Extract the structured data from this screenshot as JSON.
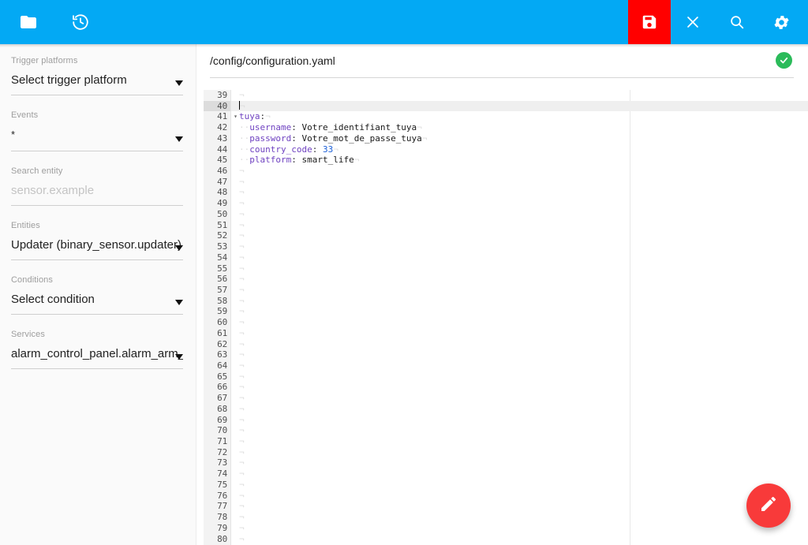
{
  "toolbar": {
    "buttons": [
      {
        "name": "browse-files-button",
        "icon": "folder-icon",
        "label": "Browse filesystem"
      },
      {
        "name": "restore-history-button",
        "icon": "history-restore-icon",
        "label": "Restore / history"
      },
      {
        "name": "save-button",
        "icon": "save-floppy-icon",
        "label": "Save",
        "bg": "#ff0000"
      },
      {
        "name": "close-button",
        "icon": "close-x-icon",
        "label": "Close"
      },
      {
        "name": "search-button",
        "icon": "search-icon",
        "label": "Search"
      },
      {
        "name": "settings-button",
        "icon": "gear-icon",
        "label": "Settings"
      }
    ],
    "accent_color": "#03a9f4",
    "save_color": "#ff0000"
  },
  "sidebar": {
    "fields": [
      {
        "name": "trigger-platforms",
        "label": "Trigger platforms",
        "value": "Select trigger platform",
        "placeholder": "",
        "is_placeholder": false
      },
      {
        "name": "events",
        "label": "Events",
        "value": "*",
        "placeholder": "",
        "is_placeholder": false
      },
      {
        "name": "search-entity",
        "label": "Search entity",
        "value": "",
        "placeholder": "sensor.example",
        "is_placeholder": true
      },
      {
        "name": "entities",
        "label": "Entities",
        "value": "Updater (binary_sensor.updater)",
        "placeholder": "",
        "is_placeholder": false
      },
      {
        "name": "conditions",
        "label": "Conditions",
        "value": "Select condition",
        "placeholder": "",
        "is_placeholder": false
      },
      {
        "name": "services",
        "label": "Services",
        "value": "alarm_control_panel.alarm_arm_aw…",
        "placeholder": "",
        "is_placeholder": false
      }
    ]
  },
  "main": {
    "file_path": "/config/configuration.yaml",
    "status_icon": "check-circle-icon",
    "status_color": "#2bbb5a"
  },
  "editor": {
    "first_visible_line": 39,
    "last_visible_line": 80,
    "active_line": 40,
    "cursor_line": 40,
    "fold_lines": [
      41
    ],
    "lines": [
      {
        "n": 39,
        "tokens": []
      },
      {
        "n": 40,
        "tokens": [],
        "cursor": true
      },
      {
        "n": 41,
        "tokens": [
          {
            "t": "key",
            "v": "tuya"
          },
          {
            "t": "punct",
            "v": ":"
          }
        ]
      },
      {
        "n": 42,
        "tokens": [
          {
            "t": "indent",
            "v": "  "
          },
          {
            "t": "key",
            "v": "username"
          },
          {
            "t": "punct",
            "v": ":"
          },
          {
            "t": "str",
            "v": " Votre_identifiant_tuya"
          }
        ]
      },
      {
        "n": 43,
        "tokens": [
          {
            "t": "indent",
            "v": "  "
          },
          {
            "t": "key",
            "v": "password"
          },
          {
            "t": "punct",
            "v": ":"
          },
          {
            "t": "str",
            "v": " Votre_mot_de_passe_tuya"
          }
        ]
      },
      {
        "n": 44,
        "tokens": [
          {
            "t": "indent",
            "v": "  "
          },
          {
            "t": "key",
            "v": "country_code"
          },
          {
            "t": "punct",
            "v": ":"
          },
          {
            "t": "num",
            "v": " 33"
          }
        ]
      },
      {
        "n": 45,
        "tokens": [
          {
            "t": "indent",
            "v": "  "
          },
          {
            "t": "key",
            "v": "platform"
          },
          {
            "t": "punct",
            "v": ":"
          },
          {
            "t": "str",
            "v": " smart_life"
          }
        ]
      },
      {
        "n": 46,
        "tokens": []
      },
      {
        "n": 47,
        "tokens": []
      },
      {
        "n": 48,
        "tokens": []
      },
      {
        "n": 49,
        "tokens": []
      },
      {
        "n": 50,
        "tokens": []
      },
      {
        "n": 51,
        "tokens": []
      },
      {
        "n": 52,
        "tokens": []
      },
      {
        "n": 53,
        "tokens": []
      },
      {
        "n": 54,
        "tokens": []
      },
      {
        "n": 55,
        "tokens": []
      },
      {
        "n": 56,
        "tokens": []
      },
      {
        "n": 57,
        "tokens": []
      },
      {
        "n": 58,
        "tokens": []
      },
      {
        "n": 59,
        "tokens": []
      },
      {
        "n": 60,
        "tokens": []
      },
      {
        "n": 61,
        "tokens": []
      },
      {
        "n": 62,
        "tokens": []
      },
      {
        "n": 63,
        "tokens": []
      },
      {
        "n": 64,
        "tokens": []
      },
      {
        "n": 65,
        "tokens": []
      },
      {
        "n": 66,
        "tokens": []
      },
      {
        "n": 67,
        "tokens": []
      },
      {
        "n": 68,
        "tokens": []
      },
      {
        "n": 69,
        "tokens": []
      },
      {
        "n": 70,
        "tokens": []
      },
      {
        "n": 71,
        "tokens": []
      },
      {
        "n": 72,
        "tokens": []
      },
      {
        "n": 73,
        "tokens": []
      },
      {
        "n": 74,
        "tokens": []
      },
      {
        "n": 75,
        "tokens": []
      },
      {
        "n": 76,
        "tokens": []
      },
      {
        "n": 77,
        "tokens": []
      },
      {
        "n": 78,
        "tokens": []
      },
      {
        "n": 79,
        "tokens": []
      },
      {
        "n": 80,
        "tokens": []
      }
    ]
  },
  "fab": {
    "name": "edit-fab",
    "icon": "pencil-icon",
    "label": "Edit",
    "color": "#f83a3a"
  }
}
